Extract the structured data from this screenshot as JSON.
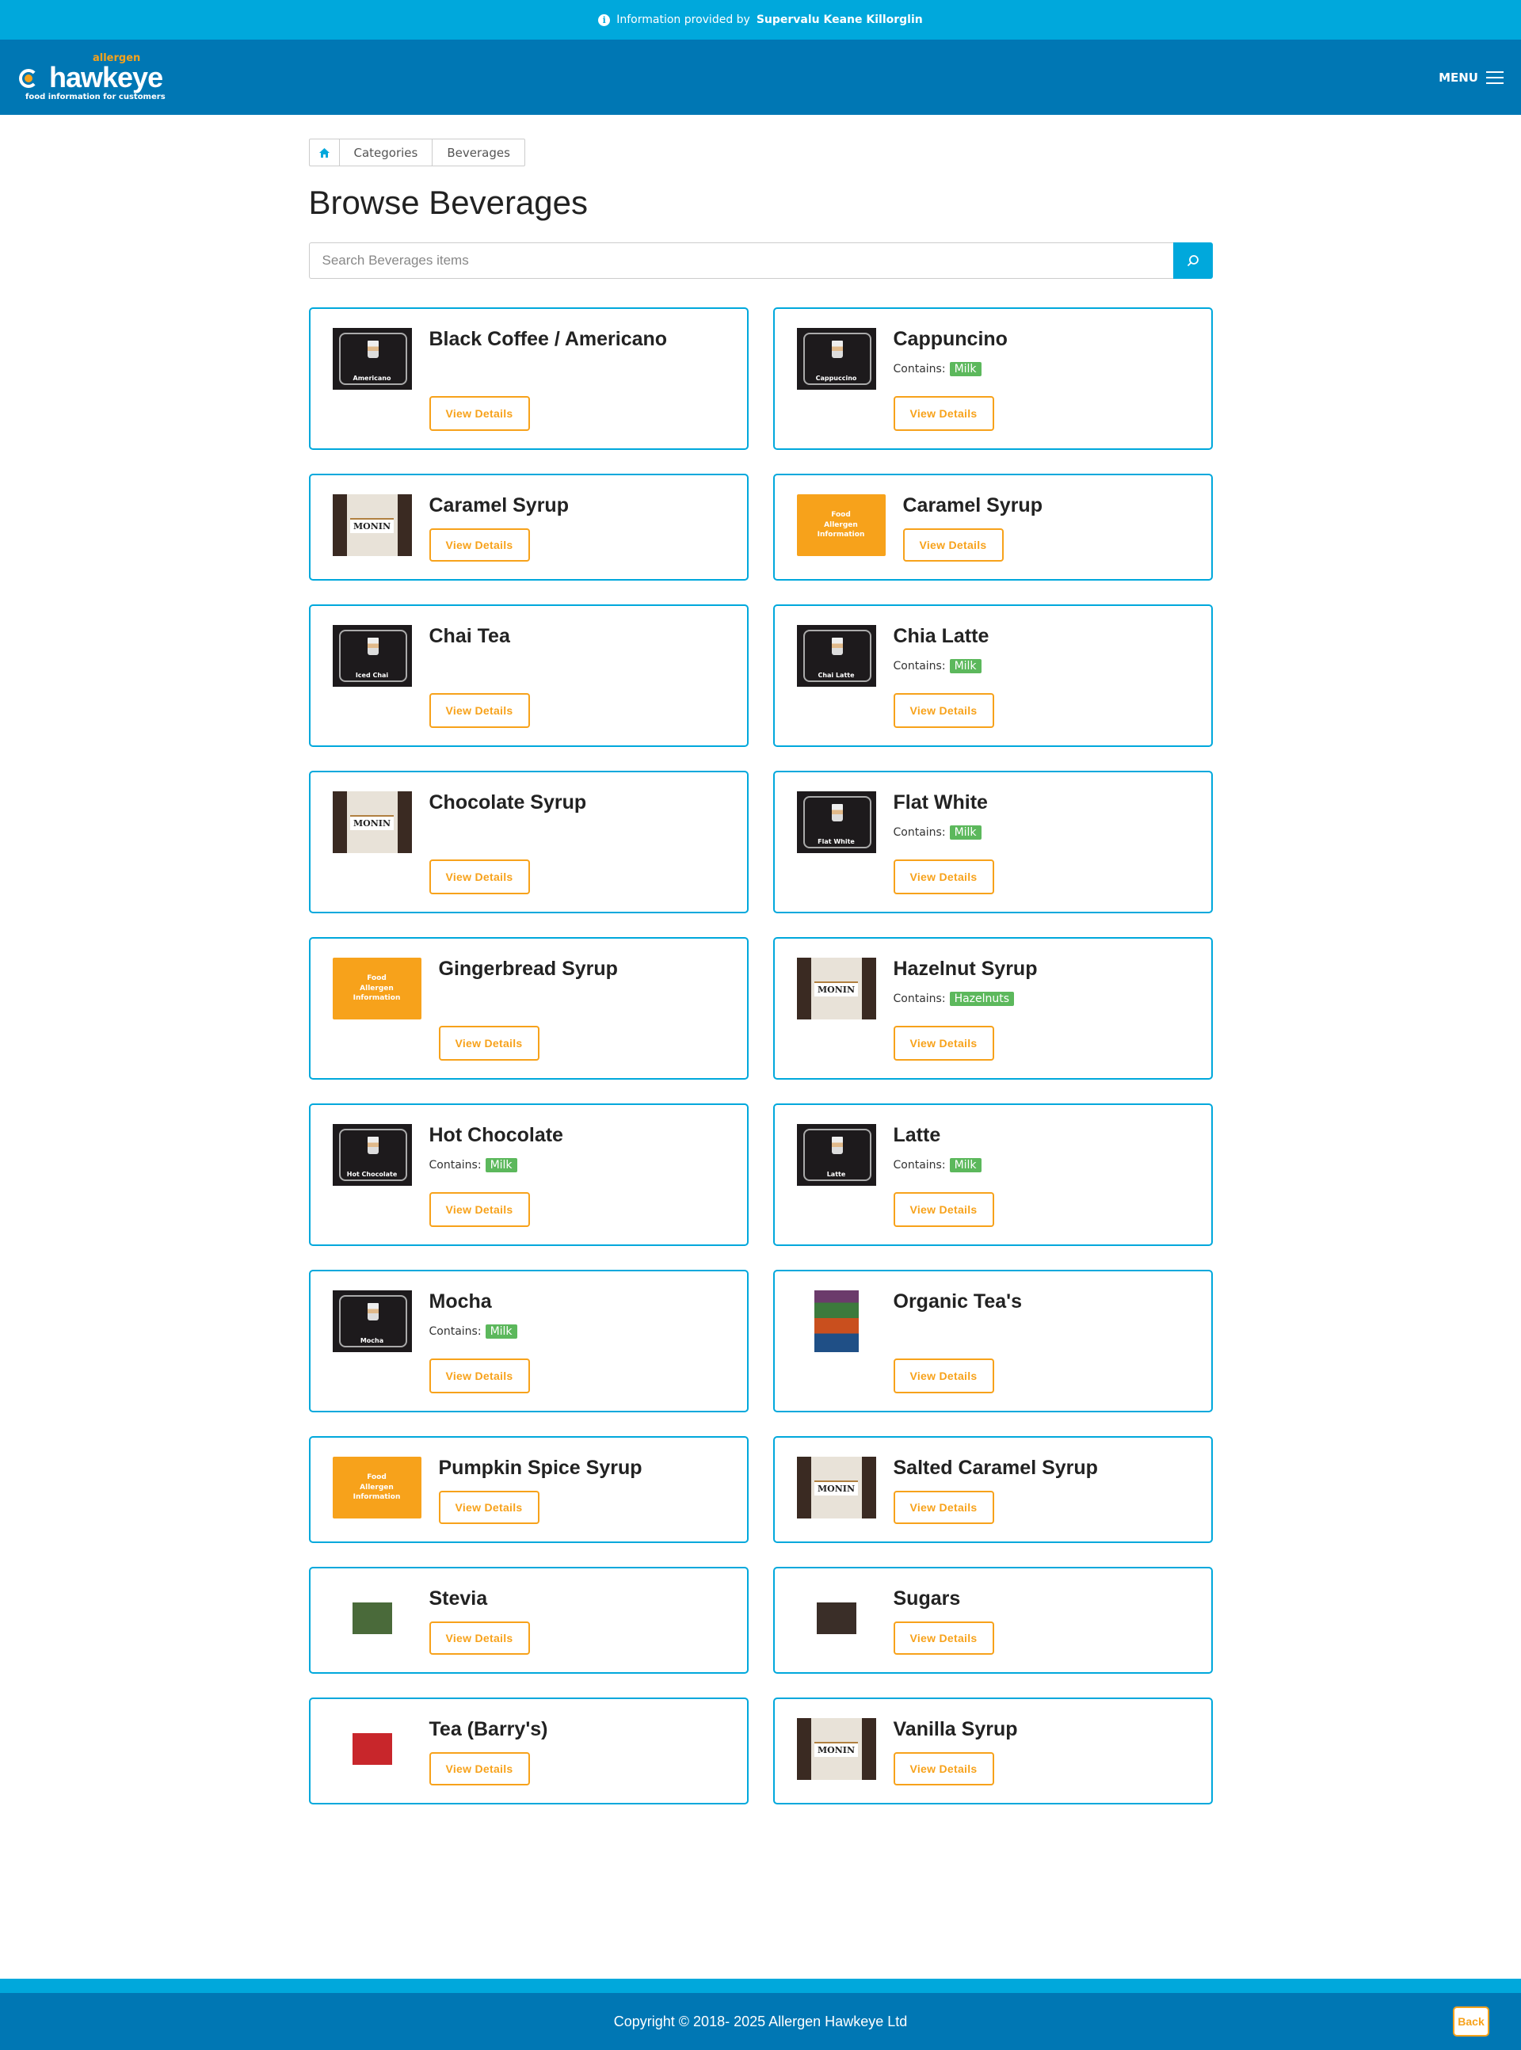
{
  "info_bar": {
    "prefix": "Information provided by",
    "store": "Supervalu Keane Killorglin"
  },
  "header": {
    "logo_small": "allergen",
    "logo_big": "hawkeye",
    "logo_tagline": "food information for customers",
    "menu_label": "MENU"
  },
  "breadcrumb": [
    "Categories",
    "Beverages"
  ],
  "page_title": "Browse Beverages",
  "search": {
    "placeholder": "Search Beverages items",
    "value": ""
  },
  "contains_label": "Contains:",
  "view_label": "View Details",
  "placeholder_image_text": [
    "Food",
    "Allergen",
    "Information"
  ],
  "items": [
    {
      "name": "Black Coffee / Americano",
      "allergens": [],
      "thumb": "dark",
      "caption": "Americano"
    },
    {
      "name": "Cappuncino",
      "allergens": [
        "Milk"
      ],
      "thumb": "dark",
      "caption": "Cappuccino"
    },
    {
      "name": "Caramel Syrup",
      "allergens": [],
      "thumb": "bottle",
      "caption": "MONIN"
    },
    {
      "name": "Caramel Syrup",
      "allergens": [],
      "thumb": "orange"
    },
    {
      "name": "Chai Tea",
      "allergens": [],
      "thumb": "dark",
      "caption": "Iced Chai"
    },
    {
      "name": "Chia Latte",
      "allergens": [
        "Milk"
      ],
      "thumb": "dark",
      "caption": "Chai Latte"
    },
    {
      "name": "Chocolate Syrup",
      "allergens": [],
      "thumb": "bottle",
      "caption": "MONIN"
    },
    {
      "name": "Flat White",
      "allergens": [
        "Milk"
      ],
      "thumb": "dark",
      "caption": "Flat White"
    },
    {
      "name": "Gingerbread Syrup",
      "allergens": [],
      "thumb": "orange"
    },
    {
      "name": "Hazelnut Syrup",
      "allergens": [
        "Hazelnuts"
      ],
      "thumb": "bottle",
      "caption": "MONIN"
    },
    {
      "name": "Hot Chocolate",
      "allergens": [
        "Milk"
      ],
      "thumb": "dark",
      "caption": "Hot Chocolate"
    },
    {
      "name": "Latte",
      "allergens": [
        "Milk"
      ],
      "thumb": "dark",
      "caption": "Latte"
    },
    {
      "name": "Mocha",
      "allergens": [
        "Milk"
      ],
      "thumb": "dark",
      "caption": "Mocha"
    },
    {
      "name": "Organic Tea's",
      "allergens": [],
      "thumb": "tea-box"
    },
    {
      "name": "Pumpkin Spice Syrup",
      "allergens": [],
      "thumb": "orange"
    },
    {
      "name": "Salted Caramel Syrup",
      "allergens": [],
      "thumb": "bottle",
      "caption": "MONIN"
    },
    {
      "name": "Stevia",
      "allergens": [],
      "thumb": "small-img",
      "color": "#4a6a3a"
    },
    {
      "name": "Sugars",
      "allergens": [],
      "thumb": "small-img",
      "color": "#3a2e28"
    },
    {
      "name": "Tea (Barry's)",
      "allergens": [],
      "thumb": "small-img",
      "color": "#c8262b"
    },
    {
      "name": "Vanilla Syrup",
      "allergens": [],
      "thumb": "bottle",
      "caption": "MONIN"
    }
  ],
  "footer": {
    "copyright": "Copyright © 2018- 2025 Allergen Hawkeye Ltd",
    "back_label": "Back"
  },
  "colors": {
    "primary": "#0077b4",
    "accent_blue": "#00a8dc",
    "orange": "#f7a21b",
    "allergen_green": "#5cb85c"
  }
}
